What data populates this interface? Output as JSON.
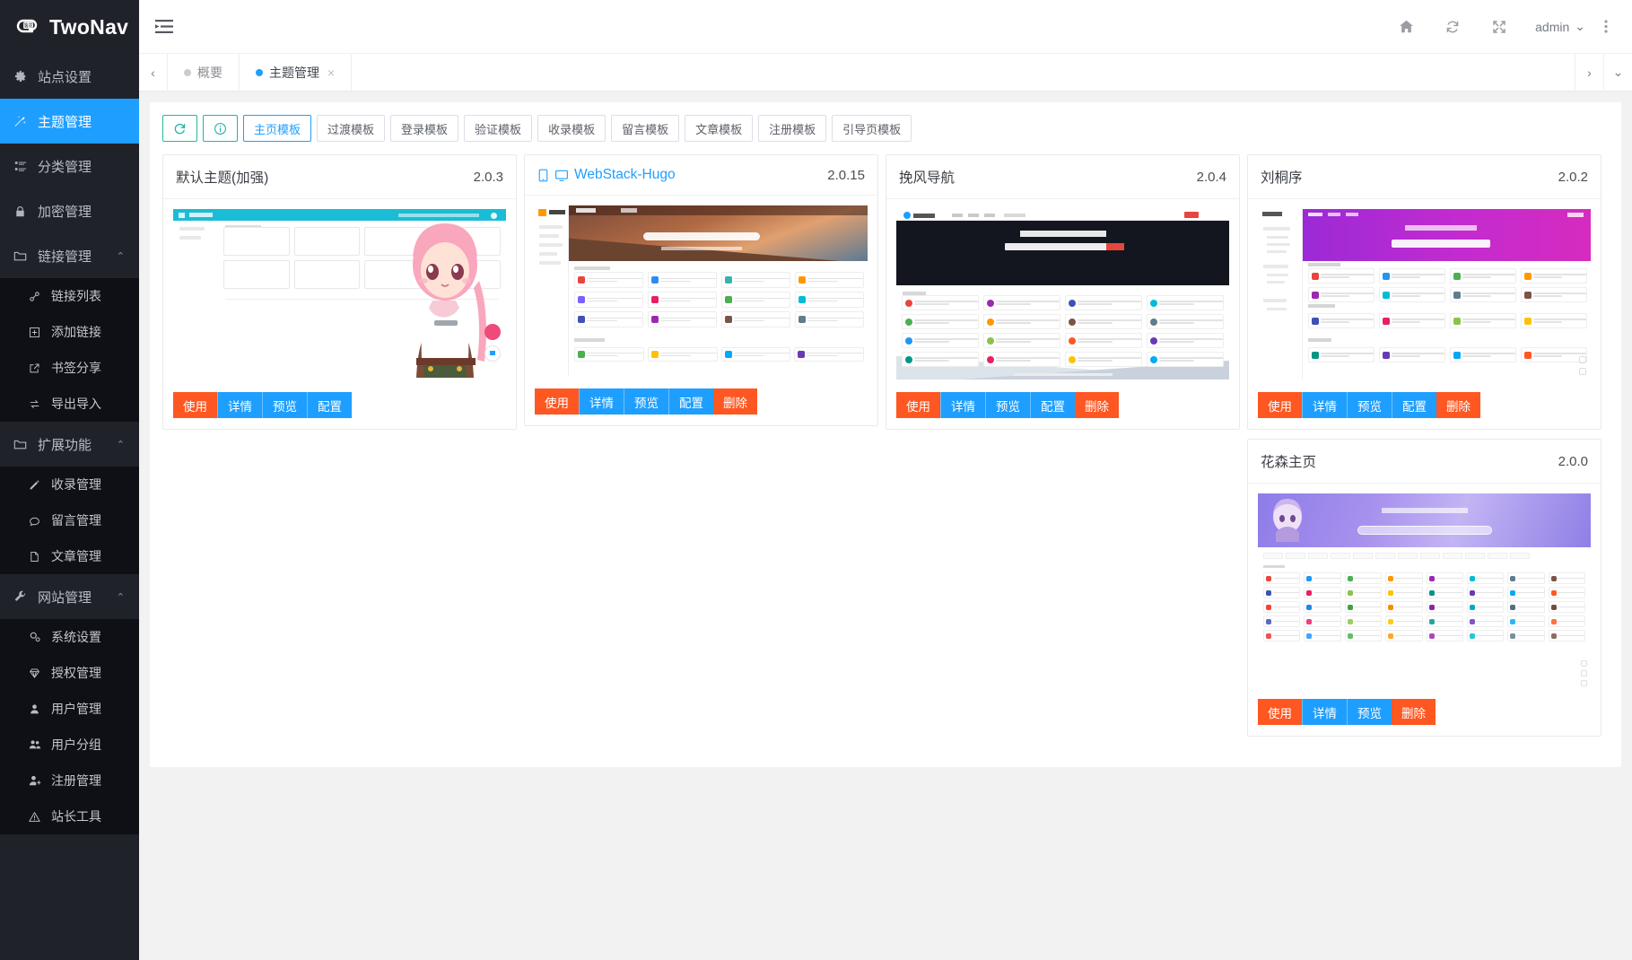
{
  "brand": {
    "title": "TwoNav",
    "logo_icon": "cloud-leaf-logo"
  },
  "sidebar": {
    "items": [
      {
        "label": "站点设置",
        "icon": "gear-icon",
        "type": "item",
        "active": false
      },
      {
        "label": "主题管理",
        "icon": "magic-wand-icon",
        "type": "item",
        "active": true
      },
      {
        "label": "分类管理",
        "icon": "list-icon",
        "type": "item",
        "active": false
      },
      {
        "label": "加密管理",
        "icon": "lock-icon",
        "type": "item",
        "active": false
      },
      {
        "label": "链接管理",
        "icon": "folder-icon",
        "type": "group",
        "caret": "⌃",
        "children": [
          {
            "label": "链接列表",
            "icon": "link-chain-icon"
          },
          {
            "label": "添加链接",
            "icon": "plus-square-icon"
          },
          {
            "label": "书签分享",
            "icon": "external-link-icon"
          },
          {
            "label": "导出导入",
            "icon": "exchange-icon"
          }
        ]
      },
      {
        "label": "扩展功能",
        "icon": "folder-icon",
        "type": "group",
        "caret": "⌃",
        "children": [
          {
            "label": "收录管理",
            "icon": "pencil-icon"
          },
          {
            "label": "留言管理",
            "icon": "comment-icon"
          },
          {
            "label": "文章管理",
            "icon": "document-icon"
          }
        ]
      },
      {
        "label": "网站管理",
        "icon": "wrench-icon",
        "type": "group",
        "caret": "⌃",
        "children": [
          {
            "label": "系统设置",
            "icon": "cogs-icon"
          },
          {
            "label": "授权管理",
            "icon": "diamond-icon"
          },
          {
            "label": "用户管理",
            "icon": "user-icon"
          },
          {
            "label": "用户分组",
            "icon": "users-icon"
          },
          {
            "label": "注册管理",
            "icon": "user-plus-icon"
          },
          {
            "label": "站长工具",
            "icon": "warning-triangle-icon"
          }
        ]
      }
    ]
  },
  "topbar": {
    "menu_toggle_icon": "hamburger-icon",
    "icons": [
      {
        "name": "home-icon",
        "glyph": "⌂"
      },
      {
        "name": "refresh-icon",
        "glyph": "⟳"
      },
      {
        "name": "fullscreen-icon",
        "glyph": "⤢"
      }
    ],
    "user": "admin",
    "user_caret": "⌄",
    "more_icon": "vertical-dots-icon"
  },
  "tabstrip": {
    "left_arrow": "‹",
    "right_arrow": "›",
    "down_arrow": "⌄",
    "tabs": [
      {
        "label": "概要",
        "active": false,
        "closable": false
      },
      {
        "label": "主题管理",
        "active": true,
        "closable": true,
        "close": "×"
      }
    ]
  },
  "toolbar": {
    "refresh_icon": "refresh-icon",
    "info_icon": "info-circle-icon",
    "filters": [
      {
        "label": "主页模板",
        "selected": true
      },
      {
        "label": "过渡模板",
        "selected": false
      },
      {
        "label": "登录模板",
        "selected": false
      },
      {
        "label": "验证模板",
        "selected": false
      },
      {
        "label": "收录模板",
        "selected": false
      },
      {
        "label": "留言模板",
        "selected": false
      },
      {
        "label": "文章模板",
        "selected": false
      },
      {
        "label": "注册模板",
        "selected": false
      },
      {
        "label": "引导页模板",
        "selected": false
      }
    ]
  },
  "colors": {
    "accent_blue": "#1E9FFF",
    "accent_orange": "#FF5722",
    "sidebar_bg": "#20222A",
    "sidebar_sub_bg": "#0f1015",
    "teal": "#22b7a8"
  },
  "themes": [
    {
      "name": "默认主题(加强)",
      "version": "2.0.3",
      "is_link": false,
      "icons": [],
      "thumb": "default-theme-preview",
      "actions": [
        {
          "label": "使用",
          "style": "orange"
        },
        {
          "label": "详情",
          "style": "blue"
        },
        {
          "label": "预览",
          "style": "blue"
        },
        {
          "label": "配置",
          "style": "blue"
        }
      ]
    },
    {
      "name": "WebStack-Hugo",
      "version": "2.0.15",
      "is_link": true,
      "icons": [
        "mobile-icon",
        "desktop-icon"
      ],
      "thumb": "webstack-hugo-preview",
      "actions": [
        {
          "label": "使用",
          "style": "orange"
        },
        {
          "label": "详情",
          "style": "blue"
        },
        {
          "label": "预览",
          "style": "blue"
        },
        {
          "label": "配置",
          "style": "blue"
        },
        {
          "label": "删除",
          "style": "orange"
        }
      ]
    },
    {
      "name": "挽风导航",
      "version": "2.0.4",
      "is_link": false,
      "icons": [],
      "thumb": "wanfeng-nav-preview",
      "actions": [
        {
          "label": "使用",
          "style": "orange"
        },
        {
          "label": "详情",
          "style": "blue"
        },
        {
          "label": "预览",
          "style": "blue"
        },
        {
          "label": "配置",
          "style": "blue"
        },
        {
          "label": "删除",
          "style": "orange"
        }
      ]
    },
    {
      "name": "刘桐序",
      "version": "2.0.2",
      "is_link": false,
      "icons": [],
      "thumb": "liutongxu-preview",
      "actions": [
        {
          "label": "使用",
          "style": "orange"
        },
        {
          "label": "详情",
          "style": "blue"
        },
        {
          "label": "预览",
          "style": "blue"
        },
        {
          "label": "配置",
          "style": "blue"
        },
        {
          "label": "删除",
          "style": "orange"
        }
      ]
    },
    {
      "name": "花森主页",
      "version": "2.0.0",
      "is_link": false,
      "icons": [],
      "thumb": "huasen-home-preview",
      "actions": [
        {
          "label": "使用",
          "style": "orange"
        },
        {
          "label": "详情",
          "style": "blue"
        },
        {
          "label": "预览",
          "style": "blue"
        },
        {
          "label": "删除",
          "style": "orange"
        }
      ]
    }
  ]
}
